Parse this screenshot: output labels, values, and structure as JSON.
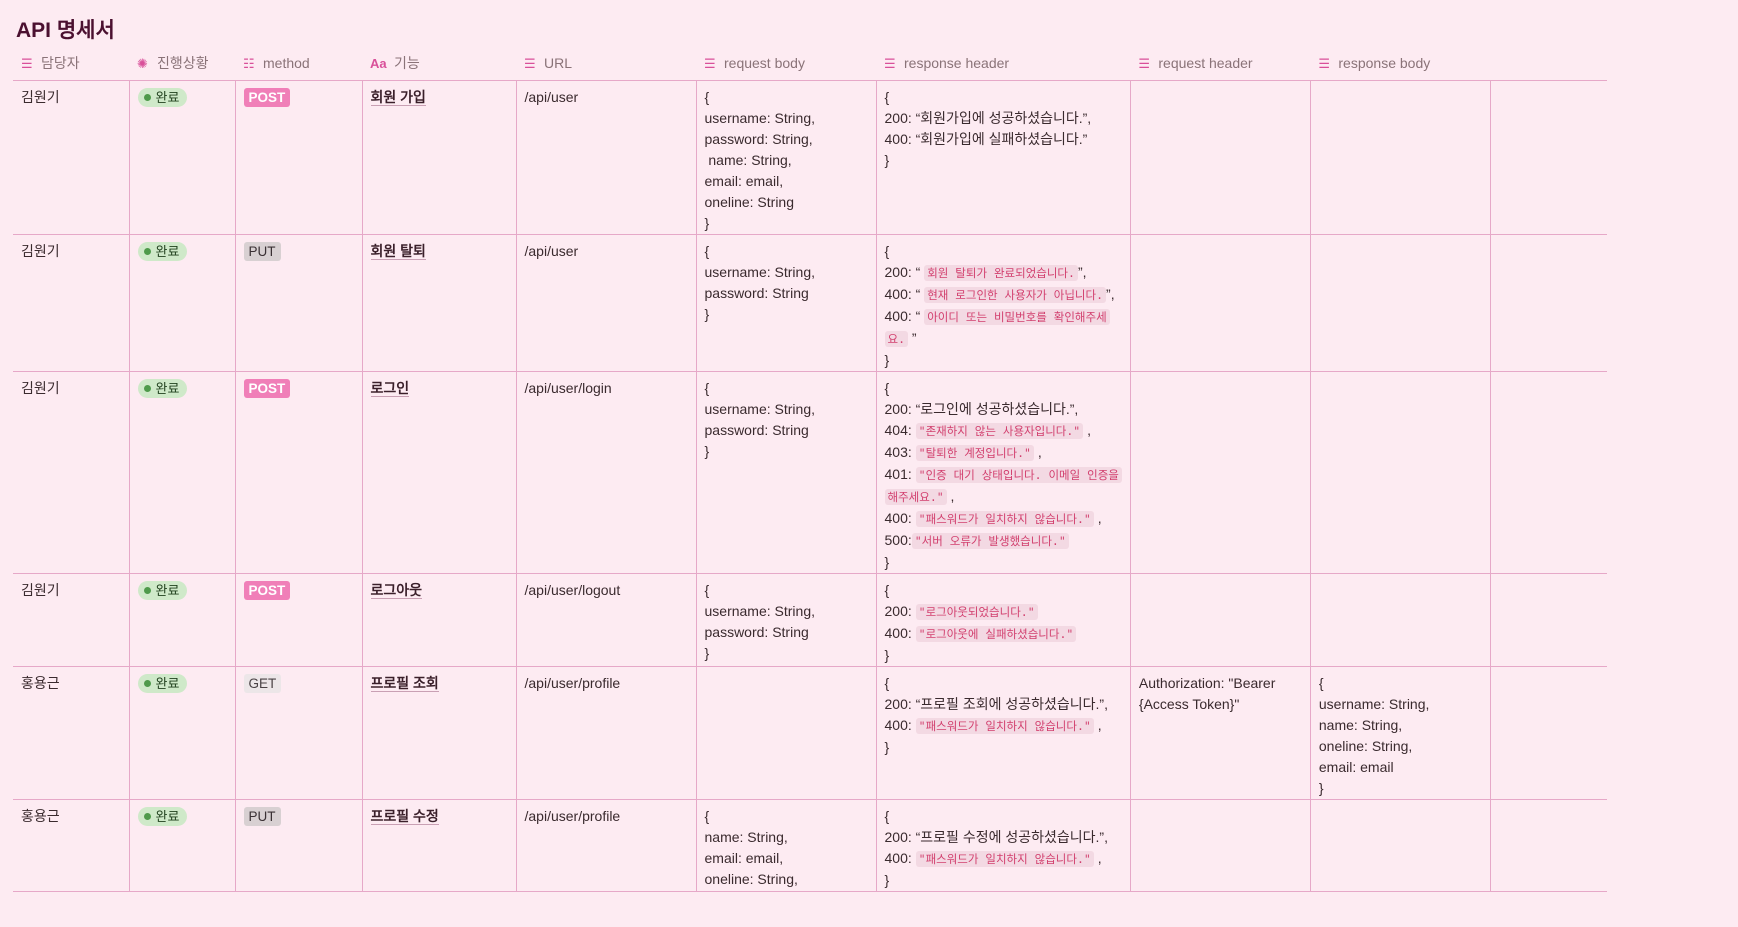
{
  "page_title": "API 명세서",
  "columns": [
    {
      "label": "담당자",
      "icon": "text-icon"
    },
    {
      "label": "진행상황",
      "icon": "status-icon"
    },
    {
      "label": "method",
      "icon": "list-icon"
    },
    {
      "label": "기능",
      "icon": "title-icon"
    },
    {
      "label": "URL",
      "icon": "text-icon"
    },
    {
      "label": "request body",
      "icon": "text-icon"
    },
    {
      "label": "response header",
      "icon": "text-icon"
    },
    {
      "label": "request header",
      "icon": "text-icon"
    },
    {
      "label": "response body",
      "icon": "text-icon"
    }
  ],
  "colors": {
    "post": "#f07fb8",
    "status_done": "#cfe9c9",
    "accent": "#d9509a"
  },
  "rows": [
    {
      "owner": "김원기",
      "status": "완료",
      "method": "POST",
      "feature": "회원 가입",
      "url": "/api/user",
      "request_body": [
        "{",
        "username: String,",
        "password: String,",
        " name: String,",
        "email: email,",
        "oneline: String",
        "}"
      ],
      "response_header": [
        [
          {
            "t": "{"
          }
        ],
        [
          {
            "t": "200: “회원가입에 성공하셨습니다.”,"
          }
        ],
        [
          {
            "t": "400: “회원가입에 실패하셨습니다.”"
          }
        ],
        [
          {
            "t": "}"
          }
        ]
      ],
      "request_header": [],
      "response_body": []
    },
    {
      "owner": "김원기",
      "status": "완료",
      "method": "PUT",
      "feature": "회원 탈퇴",
      "url": "/api/user",
      "request_body": [
        "{",
        "username: String,",
        "password: String",
        "}"
      ],
      "response_header": [
        [
          {
            "t": "{"
          }
        ],
        [
          {
            "t": "200: “ "
          },
          {
            "c": "회원 탈퇴가 완료되었습니다."
          },
          {
            "t": "”,"
          }
        ],
        [
          {
            "t": "400: “ "
          },
          {
            "c": "현재 로그인한 사용자가 아닙니다."
          },
          {
            "t": "”,"
          }
        ],
        [
          {
            "t": "400: “ "
          },
          {
            "c": "아이디 또는 비밀번호를 확인해주세"
          }
        ],
        [
          {
            "c": "요."
          },
          {
            "t": " ”"
          }
        ],
        [
          {
            "t": "}"
          }
        ]
      ],
      "request_header": [],
      "response_body": []
    },
    {
      "owner": "김원기",
      "status": "완료",
      "method": "POST",
      "feature": "로그인",
      "url": "/api/user/login",
      "request_body": [
        "{",
        "username: String,",
        "password: String",
        "}"
      ],
      "response_header": [
        [
          {
            "t": "{"
          }
        ],
        [
          {
            "t": "200: “로그인에 성공하셨습니다.”,"
          }
        ],
        [
          {
            "t": "404: "
          },
          {
            "c": "\"존재하지 않는 사용자입니다.\""
          },
          {
            "t": " ,"
          }
        ],
        [
          {
            "t": "403: "
          },
          {
            "c": "\"탈퇴한 계정입니다.\""
          },
          {
            "t": " ,"
          }
        ],
        [
          {
            "t": "401: "
          },
          {
            "c": "\"인증 대기 상태입니다. 이메일 인증을"
          }
        ],
        [
          {
            "c": "해주세요.\""
          },
          {
            "t": " ,"
          }
        ],
        [
          {
            "t": "400: "
          },
          {
            "c": "\"패스워드가 일치하지 않습니다.\""
          },
          {
            "t": " ,"
          }
        ],
        [
          {
            "t": "500:"
          },
          {
            "c": "\"서버 오류가 발생했습니다.\""
          }
        ],
        [
          {
            "t": "}"
          }
        ]
      ],
      "request_header": [],
      "response_body": []
    },
    {
      "owner": "김원기",
      "status": "완료",
      "method": "POST",
      "feature": "로그아웃",
      "url": "/api/user/logout",
      "request_body": [
        "{",
        "username: String,",
        "password: String",
        "}"
      ],
      "response_header": [
        [
          {
            "t": "{"
          }
        ],
        [
          {
            "t": "200: "
          },
          {
            "c": "\"로그아웃되었습니다.\""
          }
        ],
        [
          {
            "t": "400: "
          },
          {
            "c": "\"로그아웃에 실패하셨습니다.\""
          }
        ],
        [
          {
            "t": "}"
          }
        ]
      ],
      "request_header": [],
      "response_body": []
    },
    {
      "owner": "홍용근",
      "status": "완료",
      "method": "GET",
      "feature": "프로필 조회",
      "url": "/api/user/profile",
      "request_body": [],
      "response_header": [
        [
          {
            "t": "{"
          }
        ],
        [
          {
            "t": "200: “프로필 조회에 성공하셨습니다.”,"
          }
        ],
        [
          {
            "t": "400: "
          },
          {
            "c": "\"패스워드가 일치하지 않습니다.\""
          },
          {
            "t": " ,"
          }
        ],
        [
          {
            "t": "}"
          }
        ]
      ],
      "request_header": [
        "Authorization: \"Bearer",
        "{Access Token}\""
      ],
      "response_body": [
        "{",
        "username: String,",
        "name: String,",
        "oneline: String,",
        "email: email",
        "}"
      ]
    },
    {
      "owner": "홍용근",
      "status": "완료",
      "method": "PUT",
      "feature": "프로필 수정",
      "url": "/api/user/profile",
      "request_body": [
        "{",
        "name: String,",
        "email: email,",
        "oneline: String,"
      ],
      "response_header": [
        [
          {
            "t": "{"
          }
        ],
        [
          {
            "t": "200: “프로필 수정에 성공하셨습니다.”,"
          }
        ],
        [
          {
            "t": "400: "
          },
          {
            "c": "\"패스워드가 일치하지 않습니다.\""
          },
          {
            "t": " ,"
          }
        ],
        [
          {
            "t": "}"
          }
        ]
      ],
      "request_header": [],
      "response_body": []
    }
  ]
}
